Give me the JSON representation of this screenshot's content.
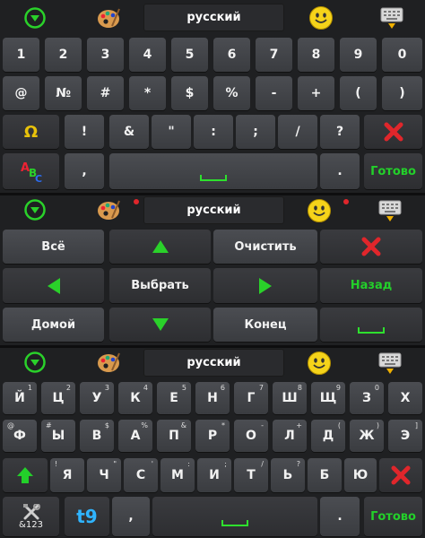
{
  "top_bar": {
    "language": "русский"
  },
  "symbols": {
    "row1": [
      "1",
      "2",
      "3",
      "4",
      "5",
      "6",
      "7",
      "8",
      "9",
      "0"
    ],
    "row2": [
      "@",
      "№",
      "#",
      "*",
      "$",
      "%",
      "-",
      "+",
      "(",
      ")"
    ],
    "row3": [
      "Ω",
      "!",
      "&",
      "\"",
      ":",
      ";",
      "/",
      "?"
    ],
    "row4": {
      "comma": ",",
      "period": ".",
      "done": "Готово"
    }
  },
  "edit": {
    "select_all": "Всё",
    "clear": "Очистить",
    "select": "Выбрать",
    "back": "Назад",
    "home": "Домой",
    "end": "Конец"
  },
  "russian": {
    "row1": [
      "Й",
      "Ц",
      "У",
      "К",
      "Е",
      "Н",
      "Г",
      "Ш",
      "Щ",
      "З",
      "Х"
    ],
    "row1_hints": [
      "1",
      "2",
      "3",
      "4",
      "5",
      "6",
      "7",
      "8",
      "9",
      "0",
      ""
    ],
    "row2": [
      "Ф",
      "Ы",
      "В",
      "А",
      "П",
      "Р",
      "О",
      "Л",
      "Д",
      "Ж",
      "Э"
    ],
    "row2_hints": [
      "@",
      "#",
      "$",
      "%",
      "&",
      "*",
      "-",
      "+",
      "(",
      ")",
      "]"
    ],
    "row3": [
      "Я",
      "Ч",
      "С",
      "М",
      "И",
      "Т",
      "Ь",
      "Б",
      "Ю"
    ],
    "row3_hints": [
      "!",
      "\"",
      "'",
      ":",
      ";",
      "/",
      "?",
      "",
      ""
    ],
    "row4": {
      "tools_label": "&123",
      "t9": "t9",
      "comma": ",",
      "period": ".",
      "done": "Готово"
    }
  },
  "colors": {
    "accent_green": "#23d02a",
    "delete_red": "#e0262b",
    "omega_yellow": "#e8c20a"
  },
  "icons": [
    "down-circle-icon",
    "palette-icon",
    "smiley-icon",
    "keyboard-hide-icon",
    "delete-x-icon",
    "abc-icon",
    "arrow-up-icon",
    "arrow-down-icon",
    "arrow-left-icon",
    "arrow-right-icon",
    "shift-icon",
    "tools-icon"
  ]
}
